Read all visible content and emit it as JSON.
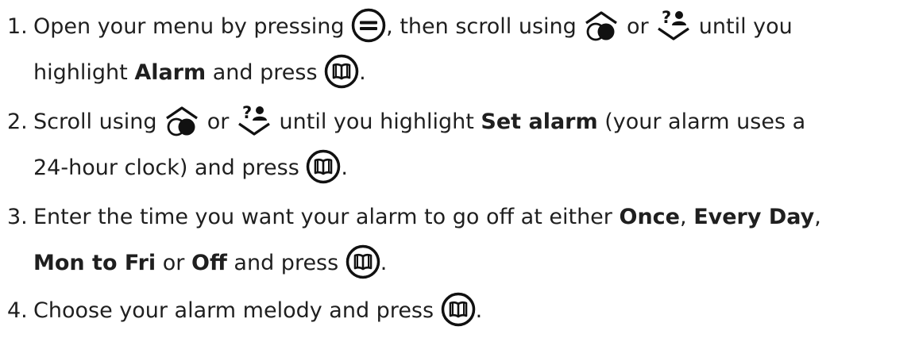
{
  "steps": [
    {
      "number": "1.",
      "l1_a": "Open your menu by pressing",
      "l1_b": ", then scroll using",
      "l1_c": "or",
      "l1_d": "until you",
      "l2_a": "highlight",
      "l2_bold": "Alarm",
      "l2_b": "and press",
      "l2_end": "."
    },
    {
      "number": "2.",
      "l1_a": "Scroll using",
      "l1_b": "or",
      "l1_c": "until you highlight",
      "l1_bold": "Set alarm",
      "l1_d": "(your alarm uses a",
      "l2_a": "24-hour clock) and press",
      "l2_end": "."
    },
    {
      "number": "3.",
      "l1_a": "Enter the time you want your alarm to go off at either",
      "l1_bold1": "Once",
      "l1_comma": ",",
      "l1_bold2": "Every Day",
      "l1_comma2": ",",
      "l2_bold1": "Mon to Fri",
      "l2_a": "or",
      "l2_bold2": "Off",
      "l2_b": "and press",
      "l2_end": "."
    },
    {
      "number": "4.",
      "l1_a": "Choose your alarm melody and press",
      "l1_end": "."
    }
  ],
  "icons": {
    "menu": "menu-button-icon",
    "up": "scroll-up-contacts-icon",
    "down": "scroll-down-help-icon",
    "ok": "ok-phonebook-button-icon"
  },
  "colors": {
    "text": "#1f1f1f",
    "icon": "#111111"
  }
}
